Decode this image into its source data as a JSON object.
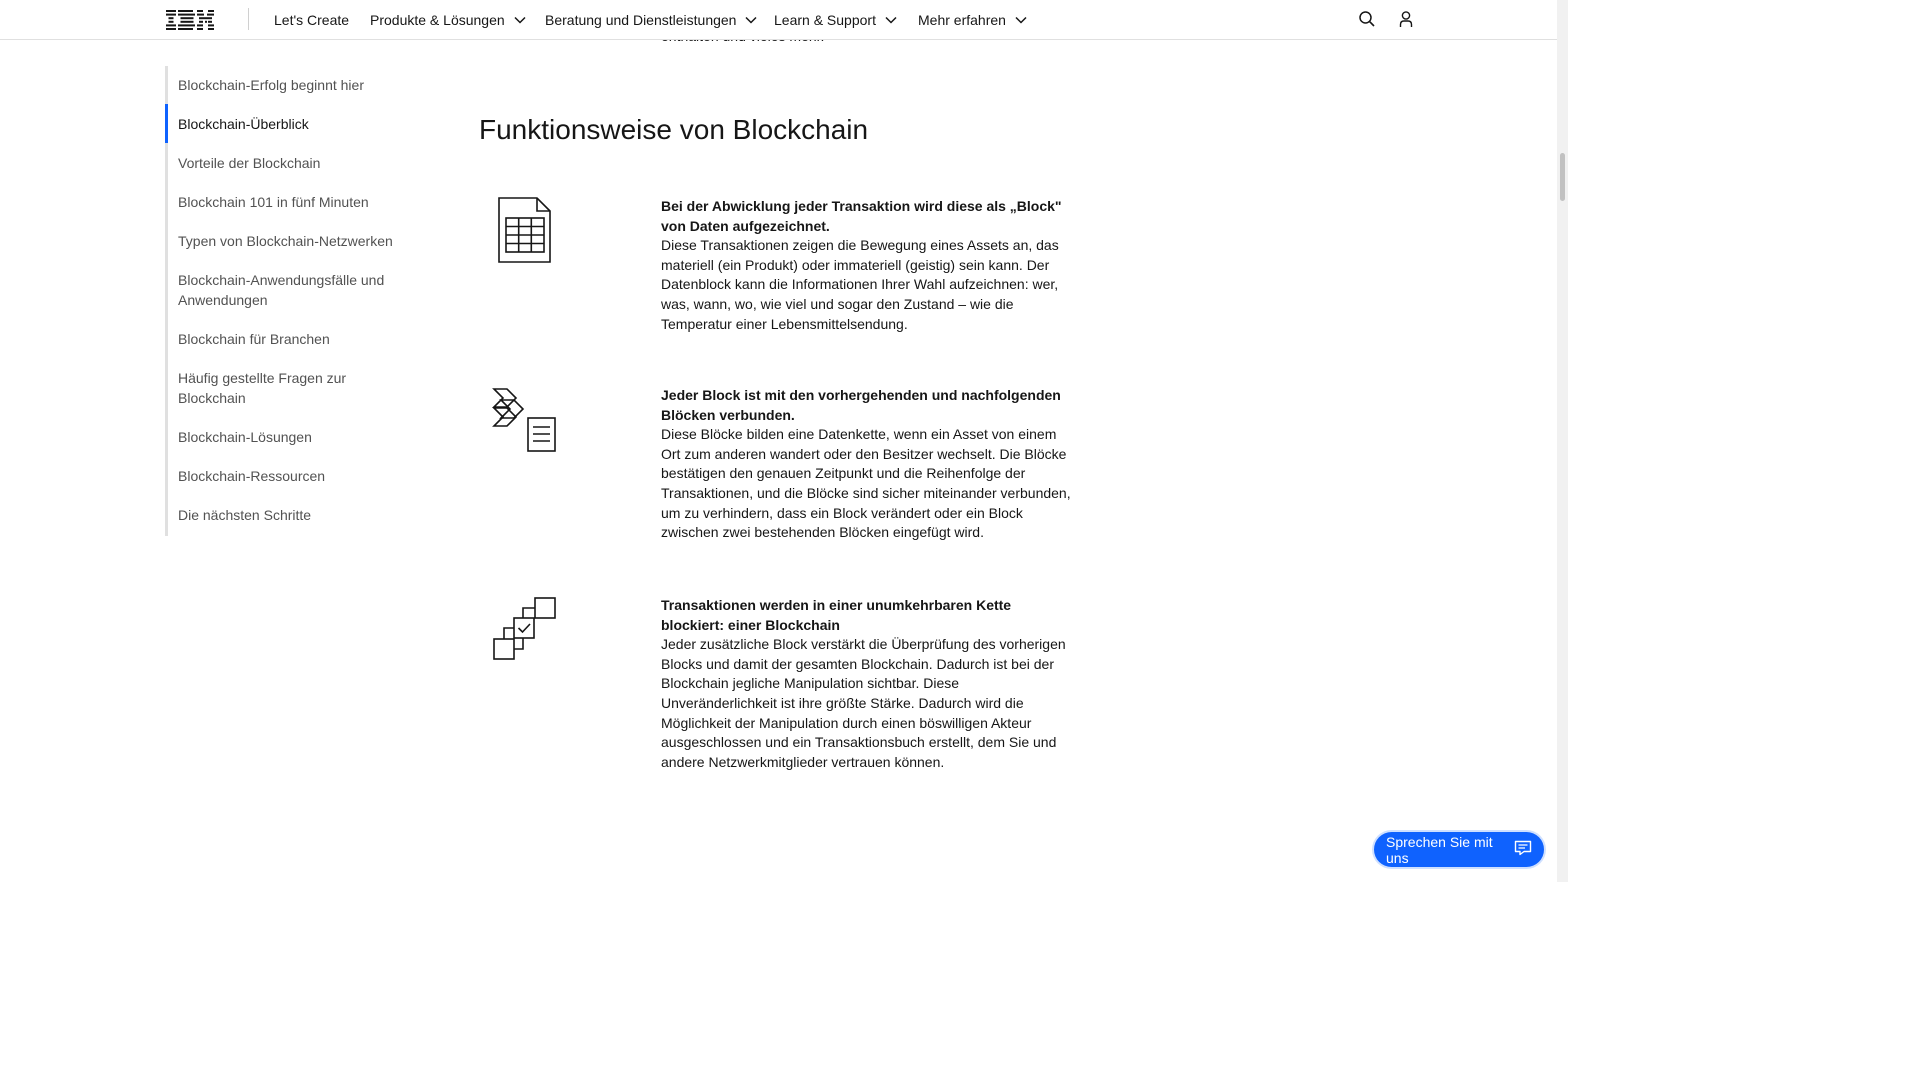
{
  "header": {
    "logo_text": "IBM",
    "nav": [
      {
        "label": "Let's Create",
        "has_dropdown": false
      },
      {
        "label": "Produkte & Lösungen",
        "has_dropdown": true
      },
      {
        "label": "Beratung und Dienstleistungen",
        "has_dropdown": true
      },
      {
        "label": "Learn & Support",
        "has_dropdown": true
      },
      {
        "label": "Mehr erfahren",
        "has_dropdown": true
      }
    ],
    "icons": [
      "search-icon",
      "user-icon"
    ]
  },
  "clipped_text": "enthalten und vieles mehr.",
  "sidenav": {
    "active_index": 1,
    "items": [
      "Blockchain-Erfolg beginnt hier",
      "Blockchain-Überblick",
      "Vorteile der Blockchain",
      "Blockchain 101 in fünf Minuten",
      "Typen von Blockchain-Netzwerken",
      "Blockchain-Anwendungsfälle und Anwendungen",
      "Blockchain für Branchen",
      "Häufig gestellte Fragen zur Blockchain",
      "Blockchain-Lösungen",
      "Blockchain-Ressourcen",
      "Die nächsten Schritte"
    ]
  },
  "main": {
    "title": "Funktionsweise von Blockchain",
    "features": [
      {
        "icon": "spreadsheet-document-icon",
        "title": "Bei der Abwicklung jeder Transaktion wird diese als „Block\" von Daten aufgezeichnet.",
        "body": "Diese Transaktionen zeigen die Bewegung eines Assets an, das materiell (ein Produkt) oder immateriell (geistig) sein kann. Der Datenblock kann die Informationen Ihrer Wahl aufzeichnen: wer, was, wann, wo, wie viel und sogar den Zustand – wie die Temperatur einer Lebensmittelsendung."
      },
      {
        "icon": "chain-link-document-icon",
        "title": "Jeder Block ist mit den vorhergehenden und nachfolgenden Blöcken verbunden.",
        "body": "Diese Blöcke bilden eine Datenkette, wenn ein Asset von einem Ort zum anderen wandert oder den Besitzer wechselt. Die Blöcke bestätigen den genauen Zeitpunkt und die Reihenfolge der Transaktionen, und die Blöcke sind sicher miteinander verbunden, um zu verhindern, dass ein Block verändert oder ein Block zwischen zwei bestehenden Blöcken eingefügt wird."
      },
      {
        "icon": "block-chain-checkmark-icon",
        "title": "Transaktionen werden in einer unumkehrbaren Kette blockiert: einer Blockchain",
        "body": "Jeder zusätzliche Block verstärkt die Überprüfung des vorherigen Blocks und damit der gesamten Blockchain. Dadurch ist bei der Blockchain jegliche Manipulation sichtbar. Diese Unveränderlichkeit ist ihre größte Stärke. Dadurch wird die Möglichkeit der Manipulation durch einen böswilligen Akteur ausgeschlossen und ein Transaktionsbuch erstellt, dem Sie und andere Netzwerkmitglieder vertrauen können."
      }
    ]
  },
  "chat": {
    "label": "Sprechen Sie mit uns",
    "icon": "chat-bubble-icon"
  },
  "colors": {
    "accent": "#0f62fe",
    "text": "#161616",
    "muted": "#525252",
    "border": "#e0e0e0"
  }
}
